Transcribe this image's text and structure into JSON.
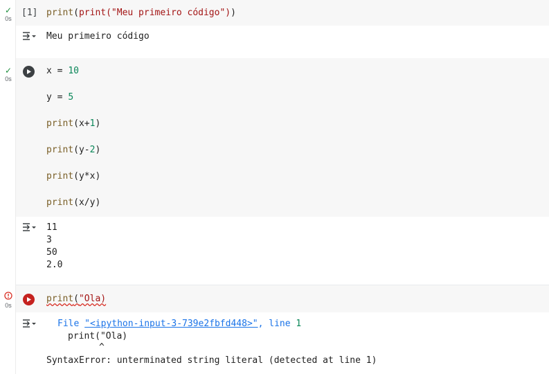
{
  "cells": [
    {
      "status": "0s",
      "exec_count": "[1]",
      "code": "print(\"Meu primeiro código\")",
      "output": [
        "Meu primeiro código"
      ]
    },
    {
      "status": "0s",
      "code_lines": [
        "x = 10",
        "y = 5",
        "print(x+1)",
        "print(y-2)",
        "print(y*x)",
        "print(x/y)"
      ],
      "output": [
        "11",
        "3",
        "50",
        "2.0"
      ]
    },
    {
      "status": "0s",
      "code": "print(\"Ola)",
      "error": {
        "file_prefix": "File ",
        "file_link": "\"<ipython-input-3-739e2fbfd448>\"",
        "line_sep": ", line ",
        "line_no": "1",
        "source": "print(\"Ola)",
        "caret": "^",
        "message": "SyntaxError: unterminated string literal (detected at line 1)"
      }
    }
  ],
  "colors": {
    "success": "#1e8e3e",
    "error": "#d93025",
    "accent": "#1a73e8"
  },
  "icons": {
    "status_ok": "check-icon",
    "status_error": "error-circle-icon",
    "run": "play-icon",
    "output_toggle": "output-collapse-icon"
  }
}
